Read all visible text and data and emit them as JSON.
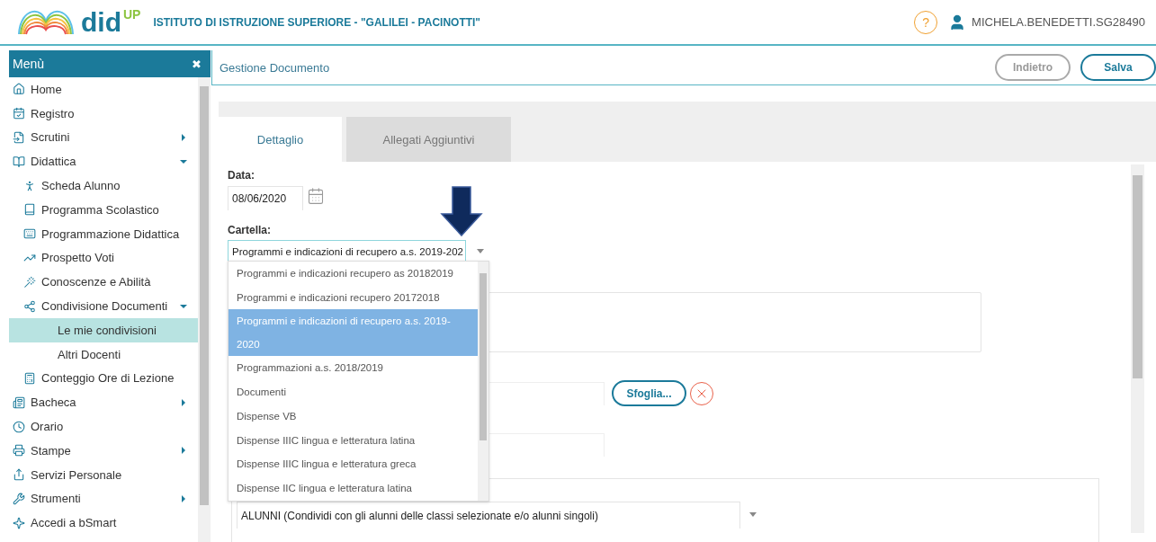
{
  "header": {
    "logo": {
      "text": "did",
      "superscript": "UP"
    },
    "school": "ISTITUTO DI ISTRUZIONE SUPERIORE - \"GALILEI - PACINOTTI\"",
    "help": "?",
    "user": "MICHELA.BENEDETTI.SG28490"
  },
  "sidebar": {
    "title": "Menù",
    "close": "✖",
    "items": [
      {
        "label": "Home",
        "selected": false
      },
      {
        "label": "Registro",
        "selected": false
      },
      {
        "label": "Scrutini",
        "selected": false,
        "expanded": false
      },
      {
        "label": "Didattica",
        "selected": false,
        "expanded": true,
        "children": [
          {
            "label": "Scheda Alunno",
            "selected": false
          },
          {
            "label": "Programma Scolastico",
            "selected": false
          },
          {
            "label": "Programmazione Didattica",
            "selected": false
          },
          {
            "label": "Prospetto Voti",
            "selected": false
          },
          {
            "label": "Conoscenze e Abilità",
            "selected": false
          },
          {
            "label": "Condivisione Documenti",
            "selected": false,
            "expanded": true,
            "children": [
              {
                "label": "Le mie condivisioni",
                "selected": true
              },
              {
                "label": "Altri Docenti",
                "selected": false
              }
            ]
          },
          {
            "label": "Conteggio Ore di Lezione",
            "selected": false
          }
        ]
      },
      {
        "label": "Bacheca",
        "selected": false,
        "expanded": false
      },
      {
        "label": "Orario",
        "selected": false
      },
      {
        "label": "Stampe",
        "selected": false,
        "expanded": false
      },
      {
        "label": "Servizi Personale",
        "selected": false
      },
      {
        "label": "Strumenti",
        "selected": false,
        "expanded": false
      },
      {
        "label": "Accedi a bSmart",
        "selected": false
      }
    ]
  },
  "page": {
    "title": "Gestione Documento",
    "buttons": [
      {
        "label": "Indietro",
        "kind": "secondary"
      },
      {
        "label": "Salva",
        "kind": "primary"
      }
    ]
  },
  "tabs": [
    {
      "label": "Dettaglio",
      "selected": true
    },
    {
      "label": "Allegati Aggiuntivi",
      "selected": false
    }
  ],
  "form": {
    "date": {
      "label": "Data:",
      "value": "08/06/2020"
    },
    "folder": {
      "label": "Cartella:",
      "value": "Programmi e indicazioni di recupero a.s. 2019-202",
      "expanded": true,
      "options": [
        {
          "label": "Programmi e indicazioni recupero as 20182019",
          "selected": false
        },
        {
          "label": "Programmi e indicazioni recupero 20172018",
          "selected": false
        },
        {
          "label": "Programmi e indicazioni di recupero a.s. 2019-2020",
          "selected": true
        },
        {
          "label": "Programmazioni a.s. 2018/2019",
          "selected": false
        },
        {
          "label": "Documenti",
          "selected": false
        },
        {
          "label": "Dispense VB",
          "selected": false
        },
        {
          "label": "Dispense IIIC lingua e letteratura latina",
          "selected": false
        },
        {
          "label": "Dispense IIIC lingua e letteratura greca",
          "selected": false
        },
        {
          "label": "Dispense IIC lingua e letteratura latina",
          "selected": false
        }
      ]
    },
    "browse_button": "Sfoglia...",
    "share_with": {
      "value": "ALUNNI (Condividi con gli alunni delle classi selezionate e/o alunni singoli)"
    }
  }
}
